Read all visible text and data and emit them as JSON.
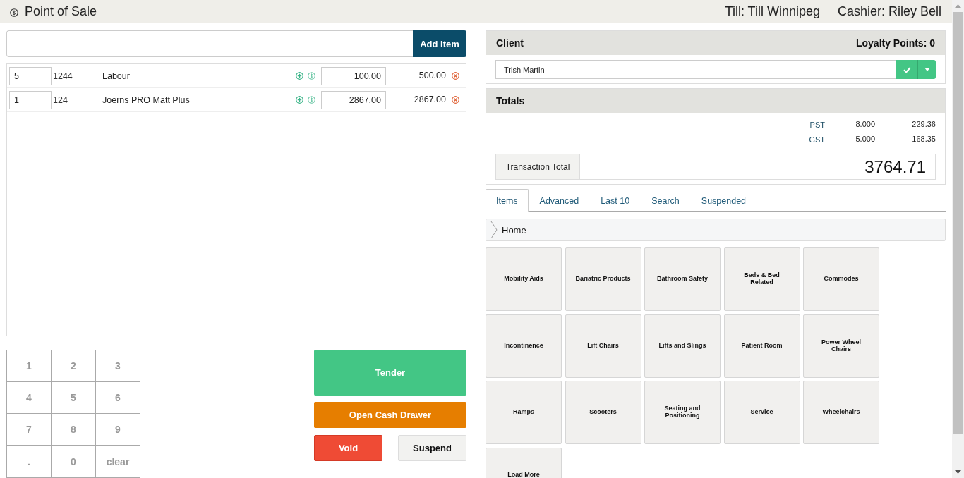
{
  "header": {
    "title": "Point of Sale",
    "till": "Till: Till Winnipeg",
    "cashier": "Cashier: Riley Bell"
  },
  "item_entry": {
    "button": "Add Item"
  },
  "line_items": [
    {
      "qty": "5",
      "code": "1244",
      "name": "Labour",
      "price": "100.00",
      "total": "500.00"
    },
    {
      "qty": "1",
      "code": "124",
      "name": "Joerns PRO Matt Plus",
      "price": "2867.00",
      "total": "2867.00"
    }
  ],
  "keypad": [
    "1",
    "2",
    "3",
    "4",
    "5",
    "6",
    "7",
    "8",
    "9",
    ".",
    "0",
    "clear"
  ],
  "actions": [
    {
      "label": "Tender",
      "kind": "tender"
    },
    {
      "label": "Open Cash Drawer",
      "kind": "drawer"
    },
    {
      "label": "Void",
      "kind": "void"
    },
    {
      "label": "Suspend",
      "kind": "suspend"
    }
  ],
  "client": {
    "title": "Client",
    "loyalty": "Loyalty Points: 0",
    "value": "Trish Martin"
  },
  "totals": {
    "title": "Totals",
    "taxes": [
      {
        "name": "PST",
        "rate": "8.000",
        "amount": "229.36"
      },
      {
        "name": "GST",
        "rate": "5.000",
        "amount": "168.35"
      }
    ],
    "total_label": "Transaction Total",
    "total_value": "3764.71"
  },
  "tabs": [
    {
      "label": "Items",
      "selected": true
    },
    {
      "label": "Advanced",
      "selected": false
    },
    {
      "label": "Last 10",
      "selected": false
    },
    {
      "label": "Search",
      "selected": false
    },
    {
      "label": "Suspended",
      "selected": false
    }
  ],
  "breadcrumb": "Home",
  "categories": [
    "Mobility Aids",
    "Bariatric Products",
    "Bathroom Safety",
    "Beds & Bed Related",
    "Commodes",
    "Incontinence",
    "Lift Chairs",
    "Lifts and Slings",
    "Patient Room",
    "Power Wheel Chairs",
    "Ramps",
    "Scooters",
    "Seating and Positioning",
    "Service",
    "Wheelchairs"
  ],
  "load_more": "Load More"
}
